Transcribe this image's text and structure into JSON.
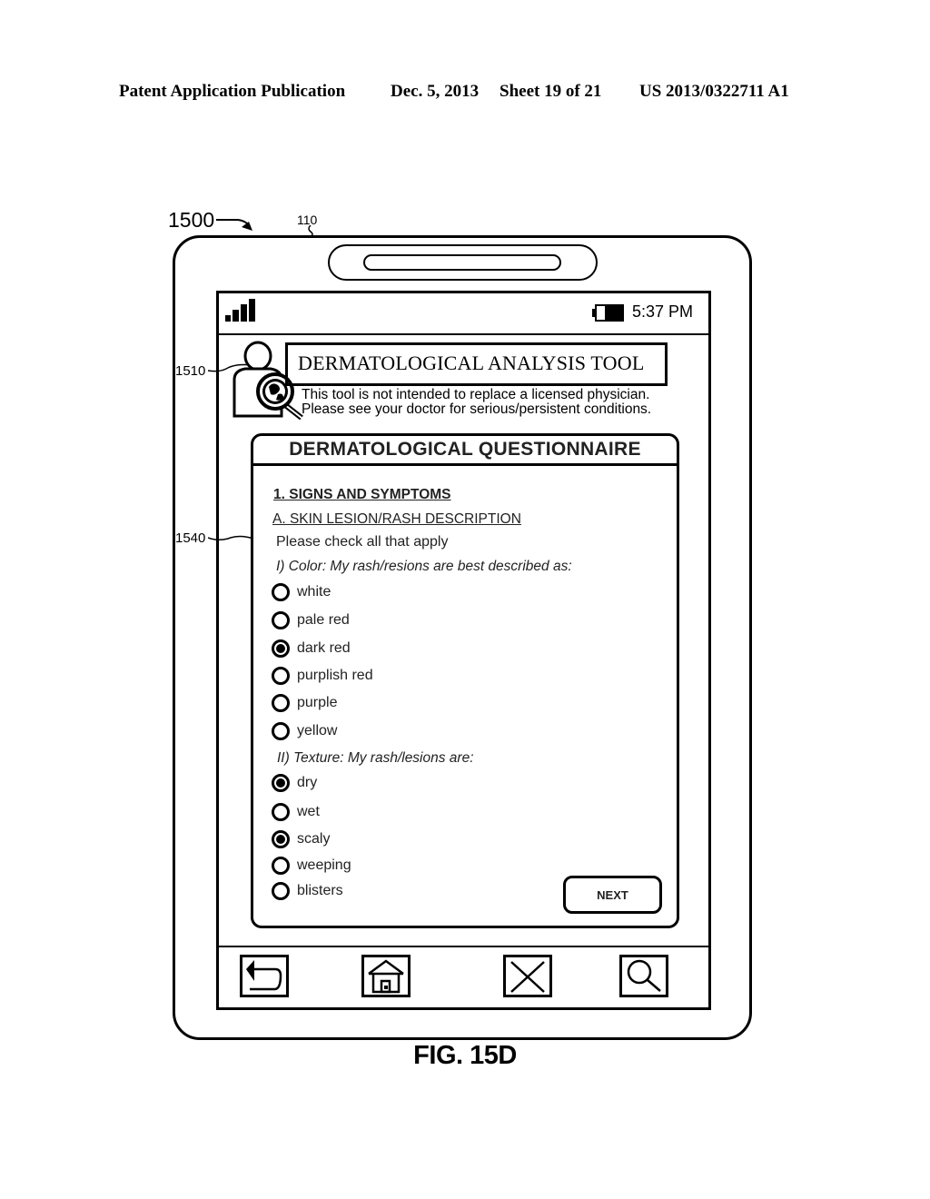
{
  "patent_header": {
    "publication": "Patent Application Publication",
    "date": "Dec. 5, 2013",
    "sheet": "Sheet 19 of 21",
    "number": "US 2013/0322711 A1"
  },
  "reference_labels": {
    "device": "1500",
    "display": "110",
    "logo": "1510",
    "questionnaire": "1540"
  },
  "status_bar": {
    "signal_icon": "signal-bars-icon",
    "battery_icon": "battery-icon",
    "time": "5:37 PM"
  },
  "app_header": {
    "logo_icon": "person-magnifier-icon",
    "title": "DERMATOLOGICAL ANALYSIS TOOL",
    "disclaimer_line1": "This tool is not intended to replace a licensed physician.",
    "disclaimer_line2": "Please see your doctor for serious/persistent conditions."
  },
  "questionnaire": {
    "title": "DERMATOLOGICAL QUESTIONNAIRE",
    "section": "1. SIGNS AND SYMPTOMS",
    "subsection": "A. SKIN LESION/RASH DESCRIPTION",
    "instruction": "Please check all that apply",
    "color_prompt": "I) Color:  My rash/resions are best described as:",
    "color_options": [
      {
        "label": "white",
        "selected": false
      },
      {
        "label": "pale red",
        "selected": false
      },
      {
        "label": "dark red",
        "selected": true
      },
      {
        "label": "purplish red",
        "selected": false
      },
      {
        "label": "purple",
        "selected": false
      },
      {
        "label": "yellow",
        "selected": false
      }
    ],
    "texture_prompt": "II) Texture:  My rash/lesions are:",
    "texture_options": [
      {
        "label": "dry",
        "selected": true
      },
      {
        "label": "wet",
        "selected": false
      },
      {
        "label": "scaly",
        "selected": true
      },
      {
        "label": "weeping",
        "selected": false
      },
      {
        "label": "blisters",
        "selected": false
      }
    ],
    "next_label": "NEXT"
  },
  "bottom_nav": {
    "items": [
      {
        "name": "back",
        "icon": "back-arrow-icon"
      },
      {
        "name": "home",
        "icon": "home-icon"
      },
      {
        "name": "close",
        "icon": "close-icon"
      },
      {
        "name": "search",
        "icon": "search-icon"
      }
    ]
  },
  "figure_label": "FIG. 15D"
}
